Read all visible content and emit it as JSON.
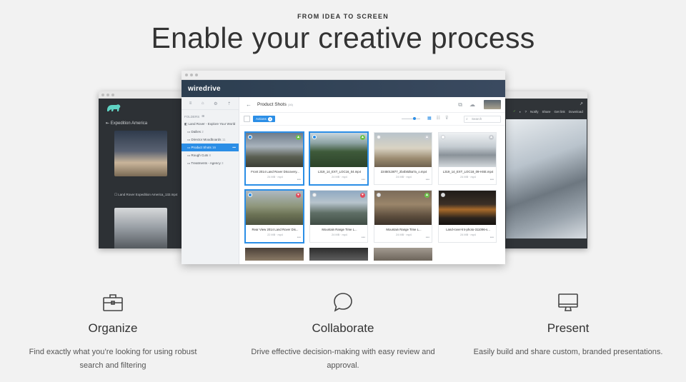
{
  "eyebrow": "FROM IDEA TO SCREEN",
  "headline": "Enable your creative process",
  "left_window": {
    "back_label": "Expedition America",
    "caption": "Land Rover Expedition America_132.mp4"
  },
  "right_window": {
    "toolbar": [
      "Notify",
      "Share",
      "Get link",
      "Download"
    ]
  },
  "app": {
    "brand": "wiredrive",
    "sidebar": {
      "folders_label": "FOLDERS",
      "items": [
        {
          "label": "Land Rover - Explore Your World",
          "count": "",
          "indent": false,
          "active": false
        },
        {
          "label": "Dailies",
          "count": "2",
          "indent": true,
          "active": false
        },
        {
          "label": "Director Moodboards",
          "count": "11",
          "indent": true,
          "active": false
        },
        {
          "label": "Product Shots",
          "count": "16",
          "indent": true,
          "active": true
        },
        {
          "label": "Rough Cuts",
          "count": "8",
          "indent": true,
          "active": false
        },
        {
          "label": "Treatments - Agency",
          "count": "3",
          "indent": true,
          "active": false
        }
      ]
    },
    "content": {
      "title": "Product Shots",
      "count": "(16)",
      "actions_label": "Actions",
      "actions_badge": "4",
      "search_placeholder": "Search"
    },
    "cards": [
      {
        "name": "Front 2014 Land Rover Discovery...",
        "meta": "24 MB · mp4",
        "selected": true,
        "mark": "green",
        "thumb": "linear-gradient(180deg,#6d7b8a 0%,#a9b3bc 40%,#5a5f52 70%,#3c3f36 100%)"
      },
      {
        "name": "L319_14_EXT_LOC16_04.mp4",
        "meta": "24 MB · mp4",
        "selected": true,
        "mark": "green",
        "thumb": "linear-gradient(180deg,#c9d6df 0%,#8da3a3 30%,#3e5a3a 55%,#2c4229 100%)"
      },
      {
        "name": "2245013877_2b4b0d5a7a_o.mp4",
        "meta": "24 MB · mp4",
        "selected": false,
        "mark": "grey",
        "thumb": "linear-gradient(180deg,#b8c3cb 0%,#d9d3c3 45%,#9b8b70 75%,#6f6250 100%)"
      },
      {
        "name": "L319_14_EXT_LOC18_09-HSE.mp4",
        "meta": "24 MB · mp4",
        "selected": false,
        "mark": "grey",
        "thumb": "linear-gradient(180deg,#eef1f3 0%,#c5ccd2 40%,#8a9299 65%,#d3d8dc 100%)"
      },
      {
        "name": "Rear View 2014 Land Rover Dis...",
        "meta": "22 MB · mp4",
        "selected": true,
        "mark": "red",
        "thumb": "linear-gradient(180deg,#aeb9c2 0%,#8f977c 45%,#6c7255 70%,#4c5240 100%)"
      },
      {
        "name": "Mountain Range Time L...",
        "meta": "24 MB · mp4",
        "selected": false,
        "mark": "red",
        "thumb": "linear-gradient(180deg,#8fa9c2 0%,#b7c4cc 35%,#5f6f66 65%,#3f4c44 100%)"
      },
      {
        "name": "Mountain Range Time L...",
        "meta": "24 MB · mp4",
        "selected": false,
        "mark": "green",
        "thumb": "linear-gradient(180deg,#7b6b59 0%,#9a856a 40%,#5c4d3d 75%,#3d332a 100%)"
      },
      {
        "name": "Land-rover-lr4-photo-311096-s...",
        "meta": "24 MB · mp4",
        "selected": false,
        "mark": "none",
        "thumb": "linear-gradient(180deg,#1f1b18 0%,#3b3026 40%,#a86a2a 55%,#2a231d 80%,#16120f 100%)"
      }
    ],
    "partial_thumbs": [
      "linear-gradient(180deg,#4b4038,#8a7a66)",
      "linear-gradient(180deg,#2c2c2c,#5f5f5f)",
      "linear-gradient(180deg,#a29a90,#6d655b)"
    ]
  },
  "features": [
    {
      "icon": "briefcase-icon",
      "title": "Organize",
      "desc1": "Find exactly what you’re looking for using robust",
      "desc2": "search and filtering"
    },
    {
      "icon": "speech-bubble-icon",
      "title": "Collaborate",
      "desc1": "Drive effective decision-making with easy review and",
      "desc2": "approval."
    },
    {
      "icon": "monitor-icon",
      "title": "Present",
      "desc1": "Easily build and share custom, branded presentations.",
      "desc2": ""
    }
  ],
  "colors": {
    "accent": "#2b8ee6",
    "brand_bar": "#2c3e50",
    "dark_window": "#2d3135",
    "background": "#f2f2f2"
  }
}
